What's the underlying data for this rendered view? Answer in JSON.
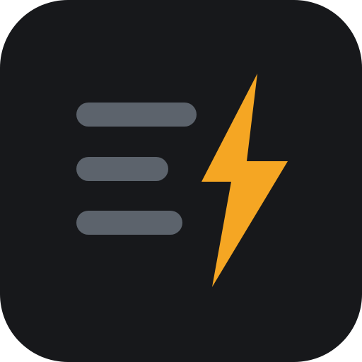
{
  "icon": {
    "name": "list-lightning-app-icon",
    "colors": {
      "tile_background": "#17181b",
      "list_bars": "#5c636c",
      "bolt": "#f5a623"
    },
    "symbols": {
      "list": "list-lines-icon",
      "bolt": "lightning-bolt-icon"
    }
  }
}
